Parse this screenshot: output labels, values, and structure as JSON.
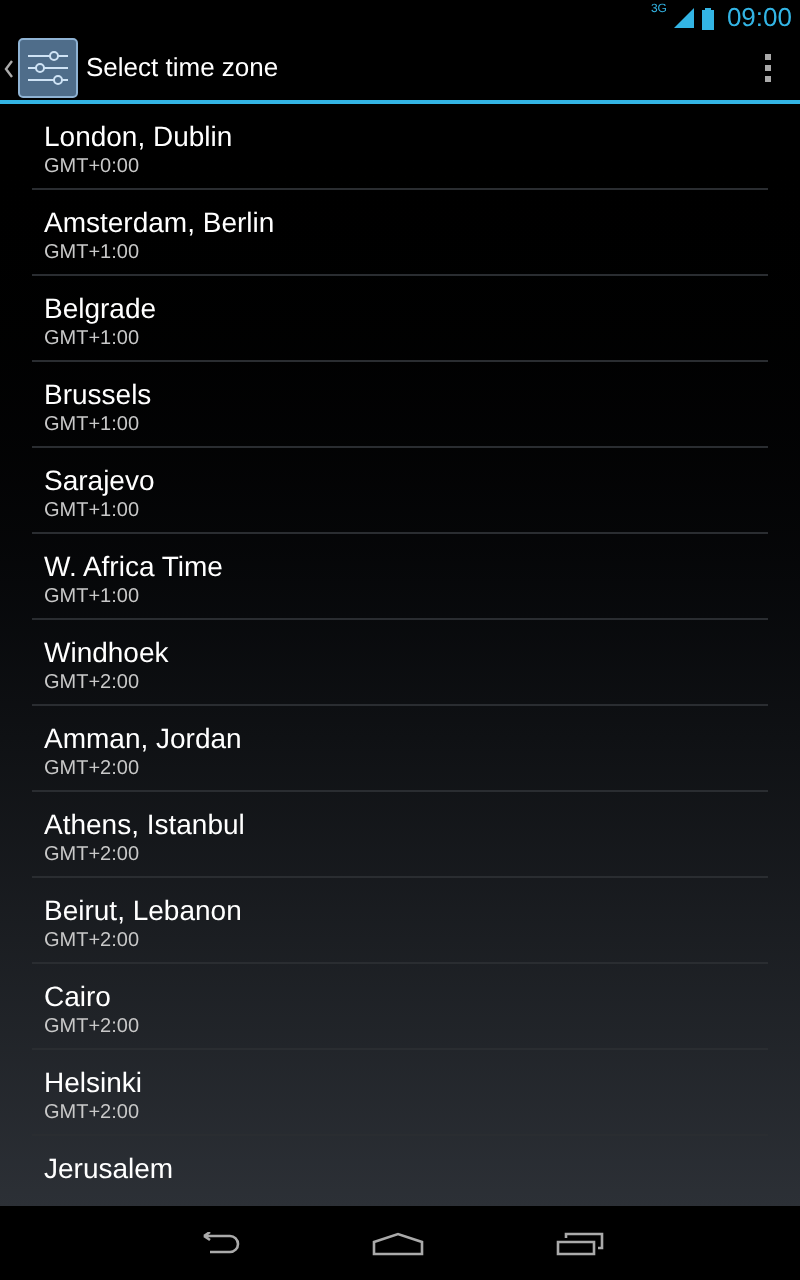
{
  "status_bar": {
    "network": "3G",
    "time": "09:00"
  },
  "action_bar": {
    "title": "Select time zone"
  },
  "zones": [
    {
      "name": "London, Dublin",
      "offset": "GMT+0:00"
    },
    {
      "name": "Amsterdam, Berlin",
      "offset": "GMT+1:00"
    },
    {
      "name": "Belgrade",
      "offset": "GMT+1:00"
    },
    {
      "name": "Brussels",
      "offset": "GMT+1:00"
    },
    {
      "name": "Sarajevo",
      "offset": "GMT+1:00"
    },
    {
      "name": "W. Africa Time",
      "offset": "GMT+1:00"
    },
    {
      "name": "Windhoek",
      "offset": "GMT+2:00"
    },
    {
      "name": "Amman, Jordan",
      "offset": "GMT+2:00"
    },
    {
      "name": "Athens, Istanbul",
      "offset": "GMT+2:00"
    },
    {
      "name": "Beirut, Lebanon",
      "offset": "GMT+2:00"
    },
    {
      "name": "Cairo",
      "offset": "GMT+2:00"
    },
    {
      "name": "Helsinki",
      "offset": "GMT+2:00"
    },
    {
      "name": "Jerusalem"
    }
  ]
}
